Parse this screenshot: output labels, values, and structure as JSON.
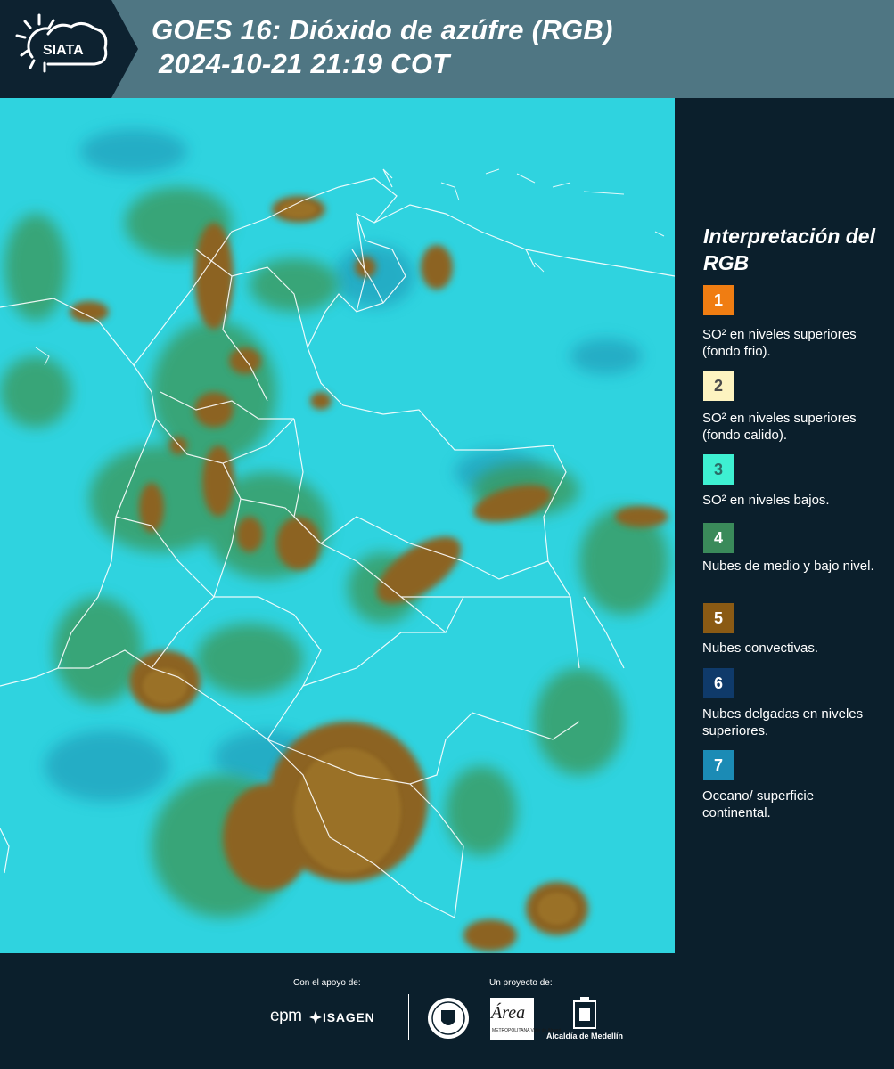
{
  "header": {
    "logo_text": "SIATA",
    "title_line1": "GOES 16: Dióxido de azúfre (RGB)",
    "title_line2": "2024-10-21 21:19 COT",
    "bg_color": "#4f7683",
    "logo_bg_color": "#0d2230"
  },
  "map": {
    "base_color": "#2fd3df",
    "border_color": "#ffffff"
  },
  "legend": {
    "title": "Interpretación del RGB",
    "items": [
      {
        "num": "1",
        "color": "#f07d12",
        "text_color": "#ffffff",
        "text": "SO² en niveles superiores (fondo frio)."
      },
      {
        "num": "2",
        "color": "#fdf3c0",
        "text_color": "#4a4a4a",
        "text": "SO² en niveles superiores (fondo calido)."
      },
      {
        "num": "3",
        "color": "#3ef0d2",
        "text_color": "#2a6d66",
        "text": "SO² en niveles bajos."
      },
      {
        "num": "4",
        "color": "#3a8a5a",
        "text_color": "#ffffff",
        "text": "Nubes de medio y bajo nivel."
      },
      {
        "num": "5",
        "color": "#8a5a14",
        "text_color": "#ffffff",
        "text": "Nubes convectivas."
      },
      {
        "num": "6",
        "color": "#0f3a6a",
        "text_color": "#ffffff",
        "text": "Nubes delgadas en niveles superiores."
      },
      {
        "num": "7",
        "color": "#1b8bb5",
        "text_color": "#ffffff",
        "text": "Oceano/ superficie continental."
      }
    ]
  },
  "footer": {
    "support_label": "Con el apoyo de:",
    "project_label": "Un proyecto de:",
    "epm_text": "epm",
    "isagen_text": "ISAGEN",
    "area_text": "Área",
    "area_sub": "METROPOLITANA Valle de Aburrá",
    "alcaldia_text": "Alcaldía de Medellín"
  }
}
